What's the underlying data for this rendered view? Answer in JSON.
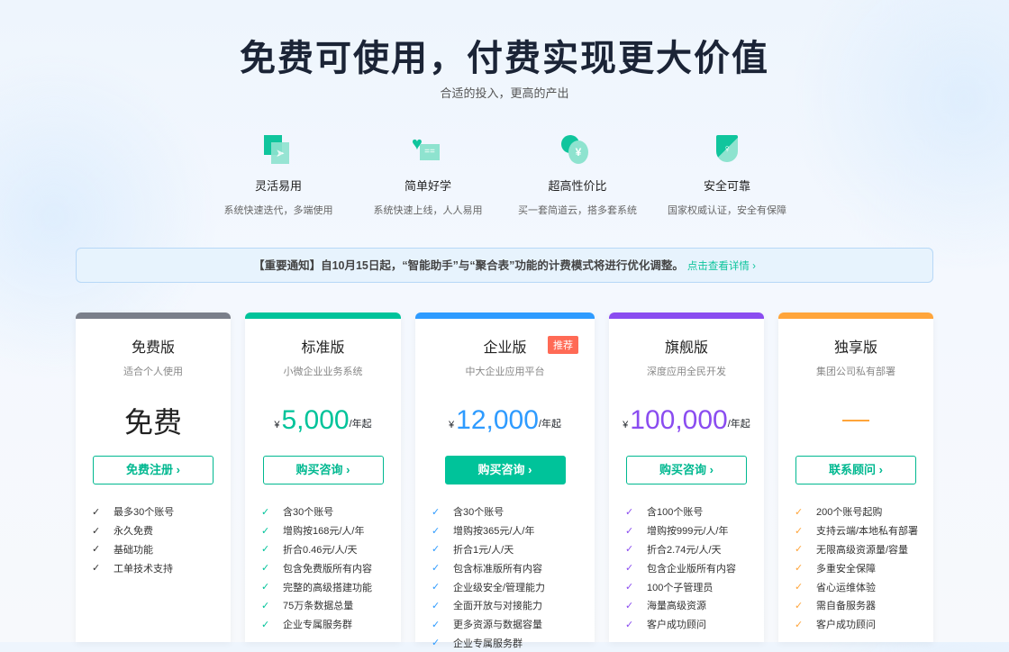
{
  "header": {
    "title": "免费可使用，付费实现更大价值",
    "subtitle": "合适的投入，更高的产出"
  },
  "features": [
    {
      "icon": "cursor-icon",
      "title": "灵活易用",
      "desc": "系统快速迭代，多端使用"
    },
    {
      "icon": "heart-list-icon",
      "title": "简单好学",
      "desc": "系统快速上线，人人易用"
    },
    {
      "icon": "yen-coin-icon",
      "title": "超高性价比",
      "desc": "买一套简道云，搭多套系统"
    },
    {
      "icon": "shield-key-icon",
      "title": "安全可靠",
      "desc": "国家权威认证，安全有保障"
    }
  ],
  "notice": {
    "text": "【重要通知】自10月15日起，“智能助手”与“聚合表”功能的计费模式将进行优化调整。",
    "link": "点击查看详情 ›"
  },
  "plans": [
    {
      "name": "免费版",
      "desc": "适合个人使用",
      "price": "免费",
      "button": "免费注册  ›",
      "color": "#7a7f8a",
      "check": "#333333",
      "features": [
        "最多30个账号",
        "永久免费",
        "基础功能",
        "工单技术支持"
      ]
    },
    {
      "name": "标准版",
      "desc": "小微企业业务系统",
      "currency": "¥",
      "price": "5,000",
      "unit": "/年起",
      "button": "购买咨询  ›",
      "color": "#00c39a",
      "check": "#00c39a",
      "features": [
        "含30个账号",
        "增购按168元/人/年",
        "折合0.46元/人/天",
        "包含免费版所有内容",
        "完整的高级搭建功能",
        "75万条数据总量",
        "企业专属服务群"
      ]
    },
    {
      "name": "企业版",
      "desc": "中大企业应用平台",
      "currency": "¥",
      "price": "12,000",
      "unit": "/年起",
      "button": "购买咨询  ›",
      "badge": "推荐",
      "color": "#2e9bff",
      "check": "#2e9bff",
      "features": [
        "含30个账号",
        "增购按365元/人/年",
        "折合1元/人/天",
        "包含标准版所有内容",
        "企业级安全/管理能力",
        "全面开放与对接能力",
        "更多资源与数据容量",
        "企业专属服务群"
      ]
    },
    {
      "name": "旗舰版",
      "desc": "深度应用全民开发",
      "currency": "¥",
      "price": "100,000",
      "unit": "/年起",
      "button": "购买咨询  ›",
      "color": "#8a4cf0",
      "check": "#8a4cf0",
      "features": [
        "含100个账号",
        "增购按999元/人/年",
        "折合2.74元/人/天",
        "包含企业版所有内容",
        "100个子管理员",
        "海量高级资源",
        "客户成功顾问"
      ]
    },
    {
      "name": "独享版",
      "desc": "集团公司私有部署",
      "price": "—",
      "button": "联系顾问  ›",
      "color": "#ffa53a",
      "check": "#ffa53a",
      "features": [
        "200个账号起购",
        "支持云端/本地私有部署",
        "无限高级资源量/容量",
        "多重安全保障",
        "省心运维体验",
        "需自备服务器",
        "客户成功顾问"
      ]
    }
  ]
}
